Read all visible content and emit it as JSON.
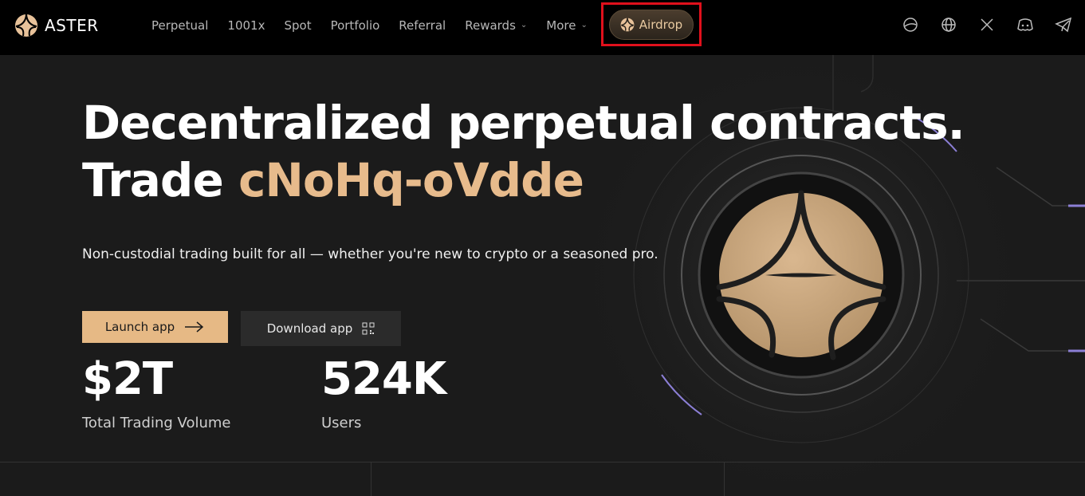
{
  "nav": {
    "brand": "ASTER",
    "links": [
      "Perpetual",
      "1001x",
      "Spot",
      "Portfolio",
      "Referral",
      "Rewards",
      "More"
    ],
    "airdrop_label": "Airdrop",
    "icons": [
      "docs-icon",
      "globe-icon",
      "x-icon",
      "discord-icon",
      "telegram-icon"
    ]
  },
  "hero": {
    "title_line1": "Decentralized perpetual contracts.",
    "title_prefix": "Trade ",
    "title_accent": "cNoHq-oVdde",
    "subtitle": "Non-custodial trading built for all — whether you're new to crypto or a seasoned pro."
  },
  "actions": {
    "launch_label": "Launch app",
    "download_label": "Download app"
  },
  "stats": [
    {
      "value": "$2T",
      "label": "Total Trading Volume"
    },
    {
      "value": "524K",
      "label": "Users"
    }
  ],
  "colors": {
    "accent": "#e7bb8c",
    "launch_bg": "#e6b985",
    "highlight_box": "#e0101c"
  }
}
